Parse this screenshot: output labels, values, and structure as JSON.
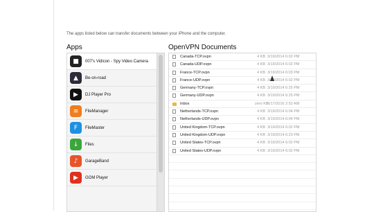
{
  "intro_text": "The apps listed below can transfer documents between your iPhone and the computer.",
  "apps": {
    "heading": "Apps",
    "items": [
      {
        "name": "007's Vidicon - Spy Video Camera",
        "icon": "camera-icon",
        "color": "#222222",
        "glyph": "■"
      },
      {
        "name": "Be-on-road",
        "icon": "navigation-icon",
        "color": "#2b2b3a",
        "glyph": "▲"
      },
      {
        "name": "DJ Player Pro",
        "icon": "play-icon",
        "color": "#111111",
        "glyph": "▶"
      },
      {
        "name": "FileManager",
        "icon": "file-manager-icon",
        "color": "#f07d1e",
        "glyph": "≡"
      },
      {
        "name": "FileMaster",
        "icon": "file-master-icon",
        "color": "#1f8fe0",
        "glyph": "F"
      },
      {
        "name": "Files",
        "icon": "download-icon",
        "color": "#3ca63c",
        "glyph": "↓"
      },
      {
        "name": "GarageBand",
        "icon": "guitar-icon",
        "color": "#e8542a",
        "glyph": "♪"
      },
      {
        "name": "GOM Player",
        "icon": "gom-player-icon",
        "color": "#e0301e",
        "glyph": "▶"
      }
    ]
  },
  "documents": {
    "heading": "OpenVPN Documents",
    "items": [
      {
        "name": "Canada-TCP.ovpn",
        "size": "4 KB",
        "date": "3/19/2014 6:02 PM",
        "type": "file"
      },
      {
        "name": "Canada-UDP.ovpn",
        "size": "4 KB",
        "date": "3/19/2014 6:02 PM",
        "type": "file"
      },
      {
        "name": "France-TCP.ovpn",
        "size": "4 KB",
        "date": "3/19/2014 6:03 PM",
        "type": "file"
      },
      {
        "name": "France-UDP.ovpn",
        "size": "4 KB",
        "date": "3/19/2014 6:02 PM",
        "type": "file"
      },
      {
        "name": "Germany-TCP.ovpn",
        "size": "4 KB",
        "date": "3/19/2014 6:25 PM",
        "type": "file"
      },
      {
        "name": "Germany-UDP.ovpn",
        "size": "4 KB",
        "date": "3/19/2014 6:25 PM",
        "type": "file"
      },
      {
        "name": "Inbox",
        "size": "zero KB",
        "date": "6/17/2016 2:52 AM",
        "type": "folder"
      },
      {
        "name": "Netherlands-TCP.ovpn",
        "size": "4 KB",
        "date": "3/19/2014 6:04 PM",
        "type": "file"
      },
      {
        "name": "Netherlands-UDP.ovpn",
        "size": "4 KB",
        "date": "3/19/2014 6:04 PM",
        "type": "file"
      },
      {
        "name": "United Kingdom-TCP.ovpn",
        "size": "4 KB",
        "date": "3/19/2014 6:02 PM",
        "type": "file"
      },
      {
        "name": "United Kingdom-UDP.ovpn",
        "size": "4 KB",
        "date": "3/19/2014 6:23 PM",
        "type": "file"
      },
      {
        "name": "United States-TCP.ovpn",
        "size": "4 KB",
        "date": "3/19/2014 6:02 PM",
        "type": "file"
      },
      {
        "name": "United States-UDP.ovpn",
        "size": "4 KB",
        "date": "3/19/2014 6:02 PM",
        "type": "file"
      }
    ]
  }
}
